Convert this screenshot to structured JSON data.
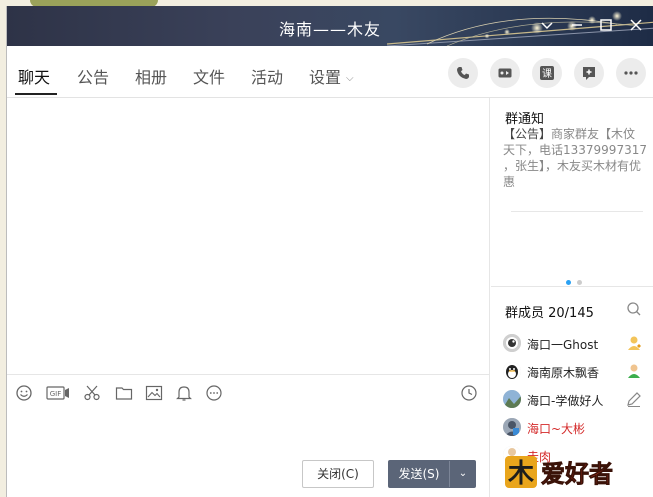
{
  "window": {
    "title": "海南——木友"
  },
  "tabs": [
    {
      "label": "聊天"
    },
    {
      "label": "公告"
    },
    {
      "label": "相册"
    },
    {
      "label": "文件"
    },
    {
      "label": "活动"
    },
    {
      "label": "设置"
    }
  ],
  "top_icons": [
    "phone-icon",
    "video-call-icon",
    "class-icon",
    "add-app-icon",
    "more-icon"
  ],
  "top_icon_labels": {
    "class": "课"
  },
  "chat_toolbar": [
    "emoji-icon",
    "gif-icon",
    "scissors-icon",
    "folder-icon",
    "image-icon",
    "bell-icon",
    "more-icon",
    "history-clock-icon"
  ],
  "chat_toolbar_labels": {
    "gif": "GIF"
  },
  "buttons": {
    "close": "关闭(C)",
    "send": "发送(S)"
  },
  "notice": {
    "title": "群通知",
    "prefix": "【公告】",
    "body": "商家群友【木伩天下，电话13379997317 ，张生】，木友买木材有优惠"
  },
  "members": {
    "title": "群成员 20/145",
    "list": [
      {
        "name": "海口一Ghost",
        "color": "#222222",
        "badge": "admin-badge-icon"
      },
      {
        "name": "海南原木飘香",
        "color": "#222222",
        "badge": "member-badge-icon"
      },
      {
        "name": "海口-学做好人",
        "color": "#222222",
        "badge": "edit-icon"
      },
      {
        "name": "海口~大彬",
        "color": "#d42a2a",
        "badge": ""
      },
      {
        "name": "走肉",
        "color": "#d42a2a",
        "badge": ""
      }
    ]
  },
  "watermark": {
    "text": "爱好者",
    "logo_char": "木"
  },
  "colors": {
    "accent_blue": "#2aa1f3",
    "send_button": "#5b6578",
    "red_name": "#d42a2a"
  }
}
